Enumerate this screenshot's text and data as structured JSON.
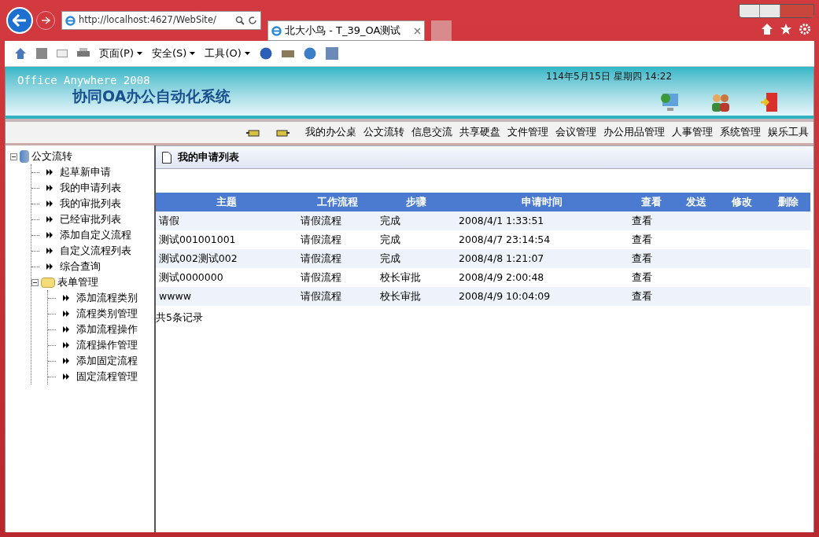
{
  "browser": {
    "address": "http://localhost:4627/WebSite/",
    "tab_title": "北大小鸟 - T_39_OA测试",
    "menus": [
      "页面(P)",
      "安全(S)",
      "工具(O)"
    ]
  },
  "banner": {
    "product": "Office Anywhere 2008",
    "system_title": "协同OA办公自动化系统",
    "datetime": "114年5月15日 星期四 14:22"
  },
  "nav": [
    "我的办公桌",
    "公文流转",
    "信息交流",
    "共享硬盘",
    "文件管理",
    "会议管理",
    "办公用品管理",
    "人事管理",
    "系统管理",
    "娱乐工具"
  ],
  "tree": {
    "label": "公文流转",
    "expanded": true,
    "children": [
      {
        "label": "起草新申请"
      },
      {
        "label": "我的申请列表"
      },
      {
        "label": "我的审批列表"
      },
      {
        "label": "已经审批列表"
      },
      {
        "label": "添加自定义流程"
      },
      {
        "label": "自定义流程列表"
      },
      {
        "label": "综合查询"
      },
      {
        "label": "表单管理",
        "expanded": true,
        "children": [
          {
            "label": "添加流程类别"
          },
          {
            "label": "流程类别管理"
          },
          {
            "label": "添加流程操作"
          },
          {
            "label": "流程操作管理"
          },
          {
            "label": "添加固定流程"
          },
          {
            "label": "固定流程管理"
          }
        ]
      }
    ]
  },
  "panel_title": "我的申请列表",
  "table": {
    "columns": [
      "主题",
      "工作流程",
      "步骤",
      "申请时间",
      "查看",
      "发送",
      "修改",
      "删除"
    ],
    "rows": [
      [
        "请假",
        "请假流程",
        "完成",
        "2008/4/1 1:33:51",
        "查看"
      ],
      [
        "测试001001001",
        "请假流程",
        "完成",
        "2008/4/7 23:14:54",
        "查看"
      ],
      [
        "测试002测试002",
        "请假流程",
        "完成",
        "2008/4/8 1:21:07",
        "查看"
      ],
      [
        "测试0000000",
        "请假流程",
        "校长审批",
        "2008/4/9 2:00:48",
        "查看"
      ],
      [
        "wwww",
        "请假流程",
        "校长审批",
        "2008/4/9 10:04:09",
        "查看"
      ]
    ]
  },
  "record_count": "共5条记录"
}
